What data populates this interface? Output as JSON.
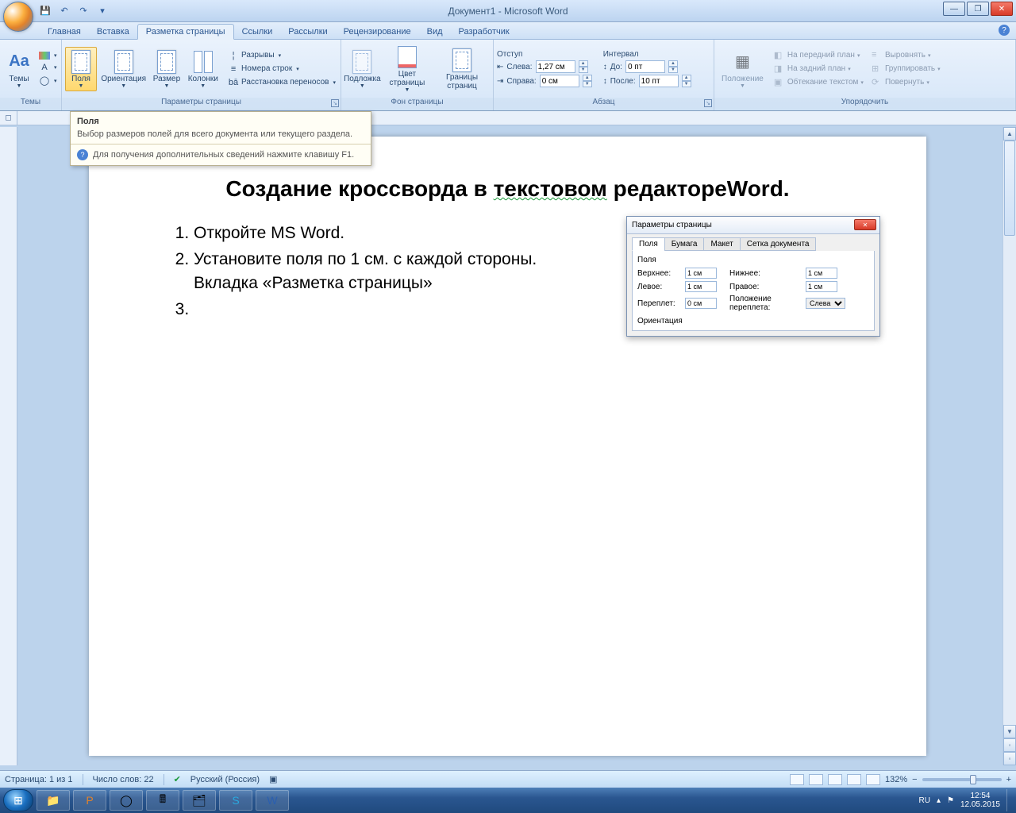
{
  "titlebar": {
    "title": "Документ1 - Microsoft Word"
  },
  "ribbon_tabs": [
    "Главная",
    "Вставка",
    "Разметка страницы",
    "Ссылки",
    "Рассылки",
    "Рецензирование",
    "Вид",
    "Разработчик"
  ],
  "active_tab_index": 2,
  "groups": {
    "themes": {
      "label": "Темы",
      "themes_btn": "Темы"
    },
    "pagesetup": {
      "label": "Параметры страницы",
      "margins": "Поля",
      "orientation": "Ориентация",
      "size": "Размер",
      "columns": "Колонки",
      "breaks": "Разрывы",
      "linenums": "Номера строк",
      "hyphen": "Расстановка переносов"
    },
    "pagebg": {
      "label": "Фон страницы",
      "watermark": "Подложка",
      "pagecolor": "Цвет страницы",
      "borders": "Границы страниц"
    },
    "paragraph": {
      "label": "Абзац",
      "indent_h": "Отступ",
      "spacing_h": "Интервал",
      "left_l": "Слева:",
      "left_v": "1,27 см",
      "right_l": "Справа:",
      "right_v": "0 см",
      "before_l": "До:",
      "before_v": "0 пт",
      "after_l": "После:",
      "after_v": "10 пт"
    },
    "arrange": {
      "label": "Упорядочить",
      "position": "Положение",
      "front": "На передний план",
      "back": "На задний план",
      "wrap": "Обтекание текстом",
      "align": "Выровнять",
      "group": "Группировать",
      "rotate": "Повернуть"
    }
  },
  "tooltip": {
    "title": "Поля",
    "body": "Выбор размеров полей для всего документа или текущего раздела.",
    "help": "Для получения дополнительных сведений нажмите клавишу F1."
  },
  "document": {
    "title_pre": "Создание кроссворда в ",
    "title_wavy": "текстовом",
    "title_post": " редактореWord.",
    "items": [
      "Откройте MS Word.",
      "Установите поля по 1 см. с каждой стороны. Вкладка «Разметка страницы»",
      ""
    ]
  },
  "pagesetup_dlg": {
    "title": "Параметры страницы",
    "tabs": [
      "Поля",
      "Бумага",
      "Макет",
      "Сетка документа"
    ],
    "section": "Поля",
    "top_l": "Верхнее:",
    "top_v": "1 см",
    "bottom_l": "Нижнее:",
    "bottom_v": "1 см",
    "left_l": "Левое:",
    "left_v": "1 см",
    "right_l": "Правое:",
    "right_v": "1 см",
    "gutter_l": "Переплет:",
    "gutter_v": "0 см",
    "gutpos_l": "Положение переплета:",
    "gutpos_v": "Слева",
    "orient_h": "Ориентация"
  },
  "statusbar": {
    "page": "Страница: 1 из 1",
    "words": "Число слов: 22",
    "lang": "Русский (Россия)",
    "zoom": "132%"
  },
  "tray": {
    "lang": "RU",
    "time": "12:54",
    "date": "12.05.2015"
  }
}
